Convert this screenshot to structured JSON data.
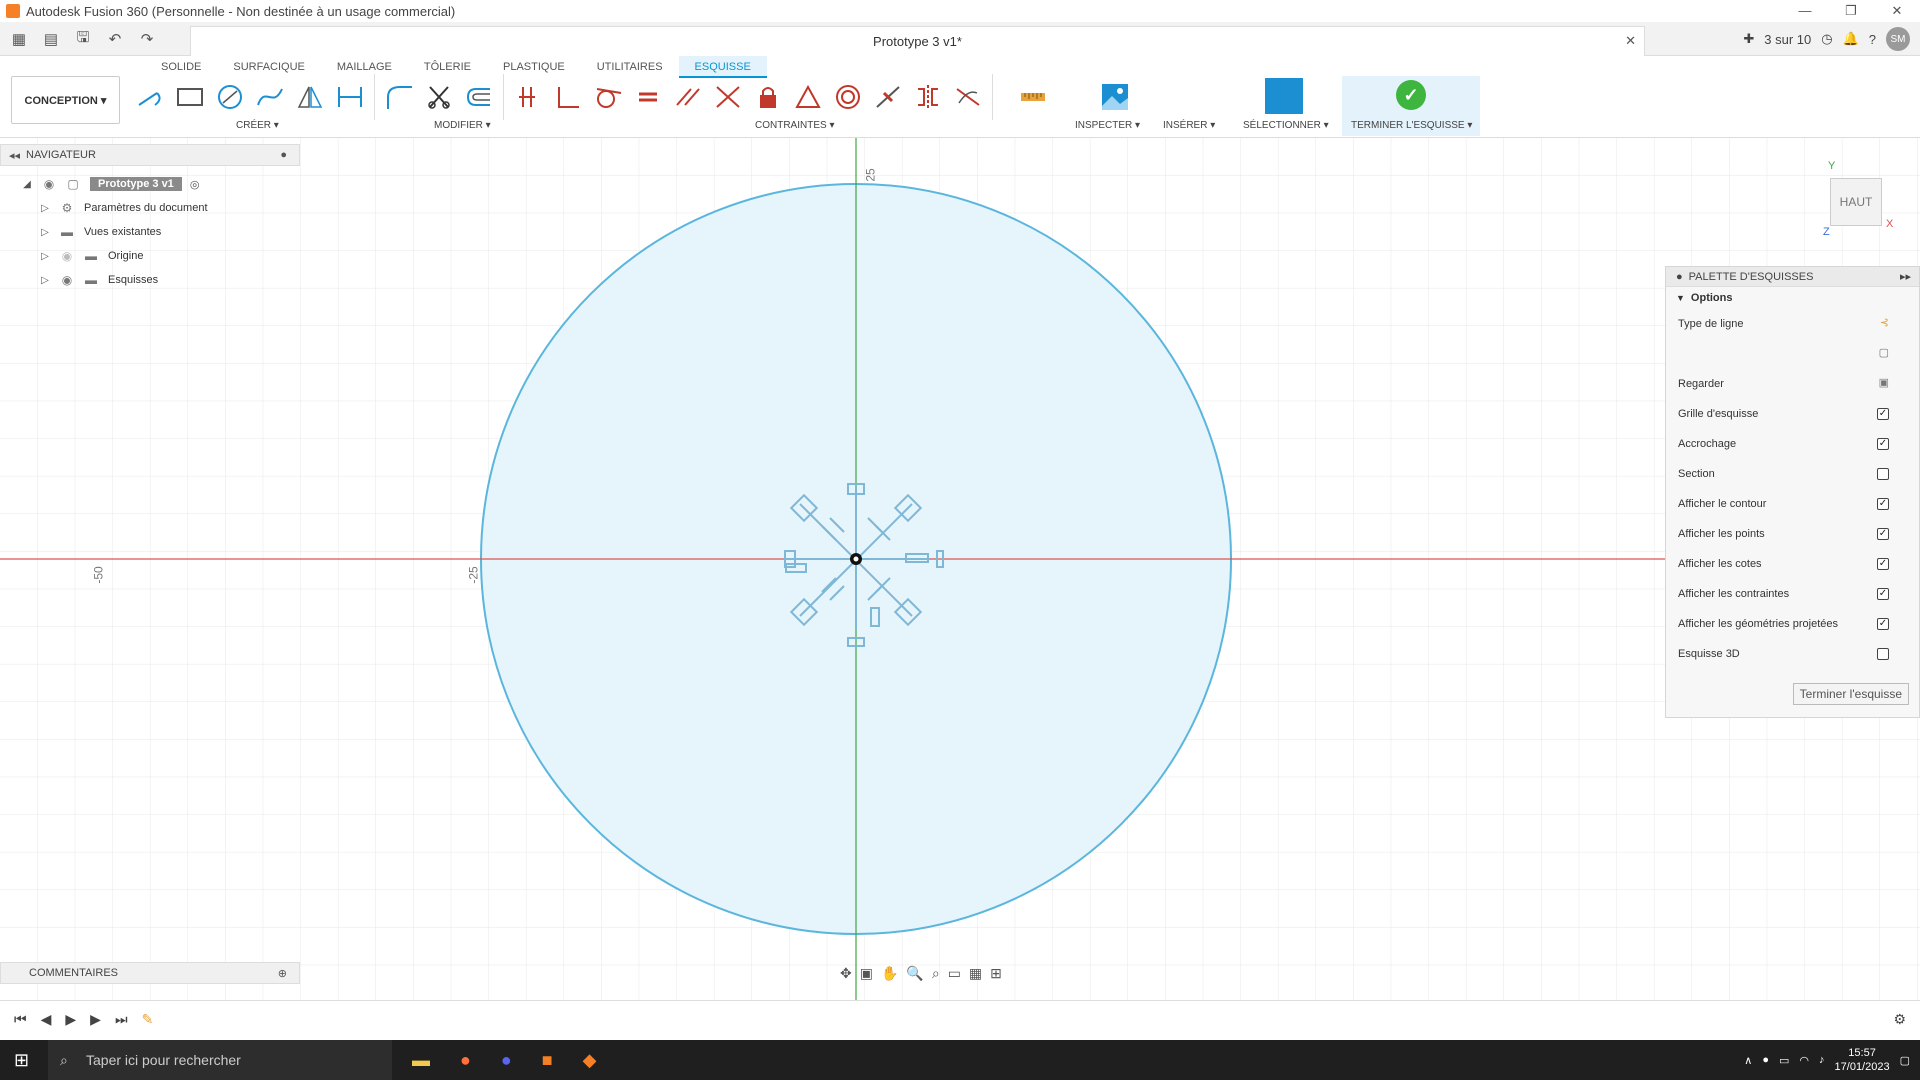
{
  "window": {
    "title": "Autodesk Fusion 360 (Personnelle - Non destinée à un usage commercial)",
    "doc_tab": "Prototype 3 v1*",
    "job_status": "3 sur 10",
    "user_initials": "SM"
  },
  "ribbon": {
    "workspace": "CONCEPTION ▾",
    "tabs": [
      "SOLIDE",
      "SURFACIQUE",
      "MAILLAGE",
      "TÔLERIE",
      "PLASTIQUE",
      "UTILITAIRES",
      "ESQUISSE"
    ],
    "active_tab": "ESQUISSE",
    "groups": {
      "create": "CRÉER ▾",
      "modify": "MODIFIER ▾",
      "constraints": "CONTRAINTES ▾",
      "inspect": "INSPECTER ▾",
      "insert": "INSÉRER ▾",
      "select": "SÉLECTIONNER ▾",
      "finish": "TERMINER L'ESQUISSE ▾"
    }
  },
  "navigator": {
    "title": "NAVIGATEUR",
    "root": "Prototype 3 v1",
    "items": [
      {
        "label": "Paramètres du document",
        "icon": "gear-icon"
      },
      {
        "label": "Vues existantes",
        "icon": "folder-icon"
      },
      {
        "label": "Origine",
        "icon": "folder-icon"
      },
      {
        "label": "Esquisses",
        "icon": "folder-icon"
      }
    ]
  },
  "comments": {
    "title": "COMMENTAIRES"
  },
  "viewcube": {
    "face": "HAUT",
    "axis_x": "X",
    "axis_y": "Y",
    "axis_z": "Z"
  },
  "canvas": {
    "axis_labels": {
      "v_25": "25",
      "h_neg50": "-50",
      "h_neg25": "-25"
    },
    "colors": {
      "circle_stroke": "#5bb6dd",
      "circle_fill": "#e6f4fb",
      "x_axis": "#d9534f",
      "y_axis": "#3fa63f",
      "grid": "#e6e6e6"
    }
  },
  "palette": {
    "title": "PALETTE D'ESQUISSES",
    "section": "Options",
    "rows": [
      {
        "label": "Type de ligne",
        "kind": "icon",
        "icon": "line-type-icon"
      },
      {
        "label": "",
        "kind": "icon",
        "icon": "construction-icon"
      },
      {
        "label": "Regarder",
        "kind": "icon",
        "icon": "look-at-icon"
      },
      {
        "label": "Grille d'esquisse",
        "kind": "check",
        "checked": true
      },
      {
        "label": "Accrochage",
        "kind": "check",
        "checked": true
      },
      {
        "label": "Section",
        "kind": "check",
        "checked": false
      },
      {
        "label": "Afficher le contour",
        "kind": "check",
        "checked": true
      },
      {
        "label": "Afficher les points",
        "kind": "check",
        "checked": true
      },
      {
        "label": "Afficher les cotes",
        "kind": "check",
        "checked": true
      },
      {
        "label": "Afficher les contraintes",
        "kind": "check",
        "checked": true
      },
      {
        "label": "Afficher les géométries projetées",
        "kind": "check",
        "checked": true
      },
      {
        "label": "Esquisse 3D",
        "kind": "check",
        "checked": false
      }
    ],
    "finish_button": "Terminer l'esquisse"
  },
  "taskbar": {
    "search_placeholder": "Taper ici pour rechercher",
    "time": "15:57",
    "date": "17/01/2023"
  }
}
